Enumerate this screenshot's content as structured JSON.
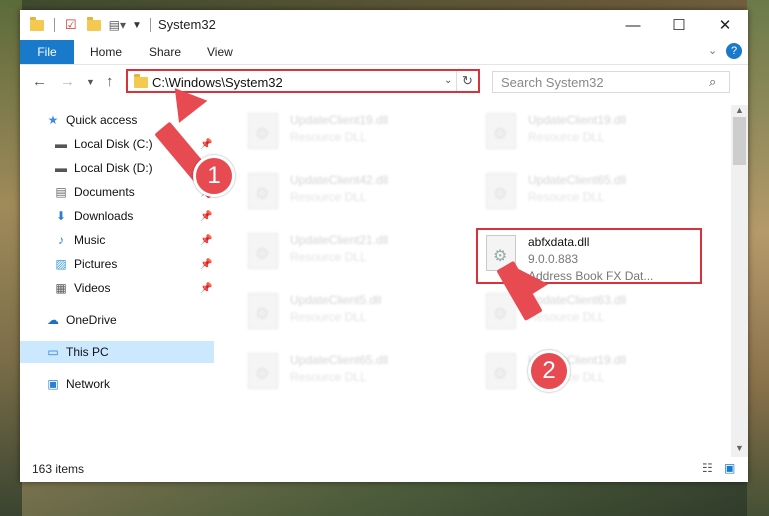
{
  "window": {
    "title": "System32",
    "minimize": "—",
    "maximize": "☐",
    "close": "✕"
  },
  "ribbon": {
    "file": "File",
    "tabs": [
      "Home",
      "Share",
      "View"
    ],
    "help": "?"
  },
  "address": {
    "path": "C:\\Windows\\System32",
    "search_placeholder": "Search System32"
  },
  "nav": {
    "items": [
      {
        "label": "Quick access",
        "icon": "star-icon"
      },
      {
        "label": "Local Disk (C:)",
        "icon": "drive-icon",
        "pinned": true
      },
      {
        "label": "Local Disk (D:)",
        "icon": "drive-icon",
        "pinned": true
      },
      {
        "label": "Documents",
        "icon": "documents-icon",
        "pinned": true
      },
      {
        "label": "Downloads",
        "icon": "download-icon",
        "pinned": true
      },
      {
        "label": "Music",
        "icon": "music-icon",
        "pinned": true
      },
      {
        "label": "Pictures",
        "icon": "pictures-icon",
        "pinned": true
      },
      {
        "label": "Videos",
        "icon": "videos-icon",
        "pinned": true
      },
      {
        "label": "OneDrive",
        "icon": "cloud-icon"
      },
      {
        "label": "This PC",
        "icon": "computer-icon",
        "selected": true
      },
      {
        "label": "Network",
        "icon": "network-icon"
      }
    ]
  },
  "files": {
    "left": [
      {
        "name": "UpdateClient19.dll",
        "type": "Resource DLL"
      },
      {
        "name": "UpdateClient42.dll",
        "type": "Resource DLL"
      },
      {
        "name": "UpdateClient21.dll",
        "type": "Resource DLL"
      },
      {
        "name": "UpdateClient5.dll",
        "type": "Resource DLL"
      },
      {
        "name": "UpdateClient65.dll",
        "type": "Resource DLL"
      }
    ],
    "right": [
      {
        "name": "UpdateClient19.dll",
        "type": "Resource DLL"
      },
      {
        "name": "UpdateClient65.dll",
        "type": "Resource DLL"
      },
      {
        "name": "UpdateClient63.dll",
        "type": "Resource DLL"
      },
      {
        "name": "UpdateClient19.dll",
        "type": "Resource DLL"
      }
    ],
    "highlighted": {
      "name": "abfxdata.dll",
      "version": "9.0.0.883",
      "description": "Address Book FX Dat..."
    }
  },
  "status": {
    "count": "163 items"
  },
  "annotations": {
    "step1": "1",
    "step2": "2"
  },
  "colors": {
    "accent": "#1979ca",
    "highlight_border": "#d9323a",
    "annotation": "#e74a50",
    "selected_bg": "#cce8ff"
  }
}
